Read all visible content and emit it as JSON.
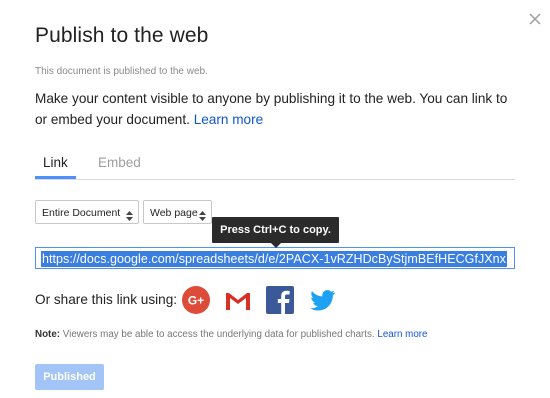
{
  "dialog": {
    "title": "Publish to the web",
    "published_note": "This document is published to the web.",
    "description": "Make your content visible to anyone by publishing it to the web. You can link to or embed your document.",
    "learn_more": "Learn more"
  },
  "tabs": [
    {
      "label": "Link",
      "active": true
    },
    {
      "label": "Embed",
      "active": false
    }
  ],
  "selects": {
    "scope": "Entire Document",
    "format": "Web page"
  },
  "tooltip": "Press Ctrl+C to copy.",
  "link": {
    "url": "https://docs.google.com/spreadsheets/d/e/2PACX-1vRZHDcByStjmBEfHECGfJXnx"
  },
  "share": {
    "label": "Or share this link using:",
    "icons": [
      "google-plus-icon",
      "gmail-icon",
      "facebook-icon",
      "twitter-icon"
    ]
  },
  "footnote": {
    "bold": "Note:",
    "text": "Viewers may be able to access the underlying data for published charts.",
    "learn_more": "Learn more"
  },
  "button": {
    "published": "Published"
  },
  "colors": {
    "accent": "#4d90fe",
    "link": "#1155cc",
    "google_plus": "#dd4b39",
    "gmail": "#d93025",
    "facebook": "#3b5998",
    "twitter": "#1da1f2"
  }
}
